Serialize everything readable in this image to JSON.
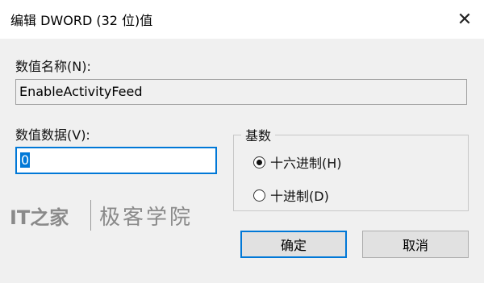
{
  "window": {
    "title": "编辑 DWORD (32 位)值",
    "close_glyph": "✕"
  },
  "fields": {
    "name_label": "数值名称(N):",
    "name_value": "EnableActivityFeed",
    "data_label": "数值数据(V):",
    "data_value": "0"
  },
  "base_group": {
    "legend": "基数",
    "options": [
      {
        "label": "十六进制(H)",
        "selected": true
      },
      {
        "label": "十进制(D)",
        "selected": false
      }
    ]
  },
  "buttons": {
    "ok": "确定",
    "cancel": "取消"
  },
  "watermark": {
    "logo": "IT之家",
    "text": "极客学院"
  },
  "colors": {
    "accent": "#0078d7",
    "background": "#f0f0f0"
  }
}
